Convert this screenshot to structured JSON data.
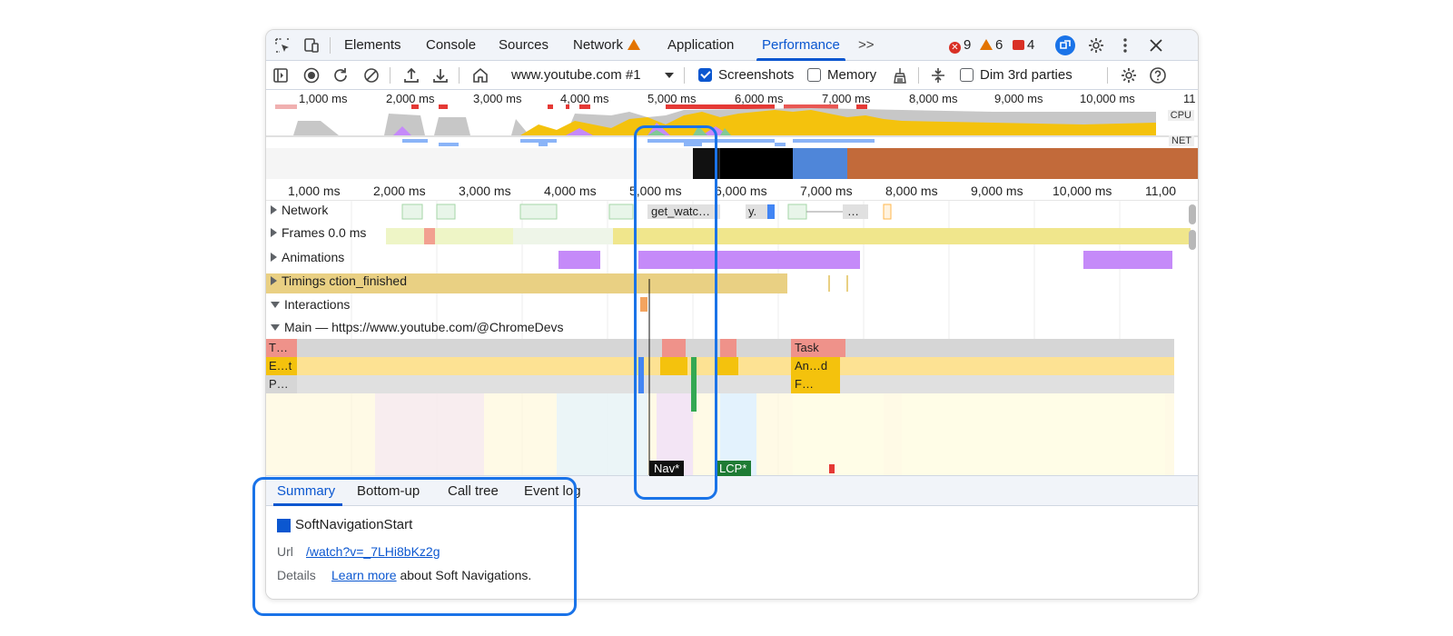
{
  "tabs": {
    "items": [
      "Elements",
      "Console",
      "Sources",
      "Network",
      "Application",
      "Performance"
    ],
    "active": "Performance",
    "more": ">>"
  },
  "badges": {
    "errors": "9",
    "warnings": "6",
    "issues": "4"
  },
  "toolbar": {
    "recording_select": "www.youtube.com #1",
    "screenshots_label": "Screenshots",
    "memory_label": "Memory",
    "dim_label": "Dim 3rd parties",
    "screenshots_checked": true,
    "memory_checked": false,
    "dim_checked": false
  },
  "overview": {
    "ticks": [
      "1,000 ms",
      "2,000 ms",
      "3,000 ms",
      "4,000 ms",
      "5,000 ms",
      "6,000 ms",
      "7,000 ms",
      "8,000 ms",
      "9,000 ms",
      "10,000 ms",
      "11"
    ],
    "cpu_label": "CPU",
    "net_label": "NET"
  },
  "ruler": {
    "ticks": [
      "1,000 ms",
      "2,000 ms",
      "3,000 ms",
      "4,000 ms",
      "5,000 ms",
      "6,000 ms",
      "7,000 ms",
      "8,000 ms",
      "9,000 ms",
      "10,000 ms",
      "11,00"
    ]
  },
  "tracks": {
    "network": "Network",
    "network_req1": "get_watc…",
    "network_req2": "y.",
    "network_req3": "…",
    "frames": "Frames",
    "frames_value": "0.0 ms",
    "animations": "Animations",
    "timings": "Timings",
    "timings_value": "ction_finished",
    "interactions": "Interactions",
    "main": "Main — https://www.youtube.com/@ChromeDevs"
  },
  "flame": {
    "row1_left": "T…",
    "row2_left": "E…t",
    "row3_left": "P…",
    "task": "Task",
    "and": "An…d",
    "f": "F…"
  },
  "markers": {
    "nav": "Nav*",
    "lcp": "LCP*"
  },
  "bottom_tabs": {
    "items": [
      "Summary",
      "Bottom-up",
      "Call tree",
      "Event log"
    ],
    "active": "Summary"
  },
  "summary": {
    "title": "SoftNavigationStart",
    "url_key": "Url",
    "url_value": "/watch?v=_7LHi8bKz2g",
    "details_key": "Details",
    "learn_more": "Learn more",
    "details_rest": "about Soft Navigations."
  },
  "colors": {
    "accent": "#0b57d0",
    "scripting": "#f4c20d",
    "rendering": "#c58af9",
    "painting": "#81c995",
    "highlight": "#1a73e8"
  }
}
